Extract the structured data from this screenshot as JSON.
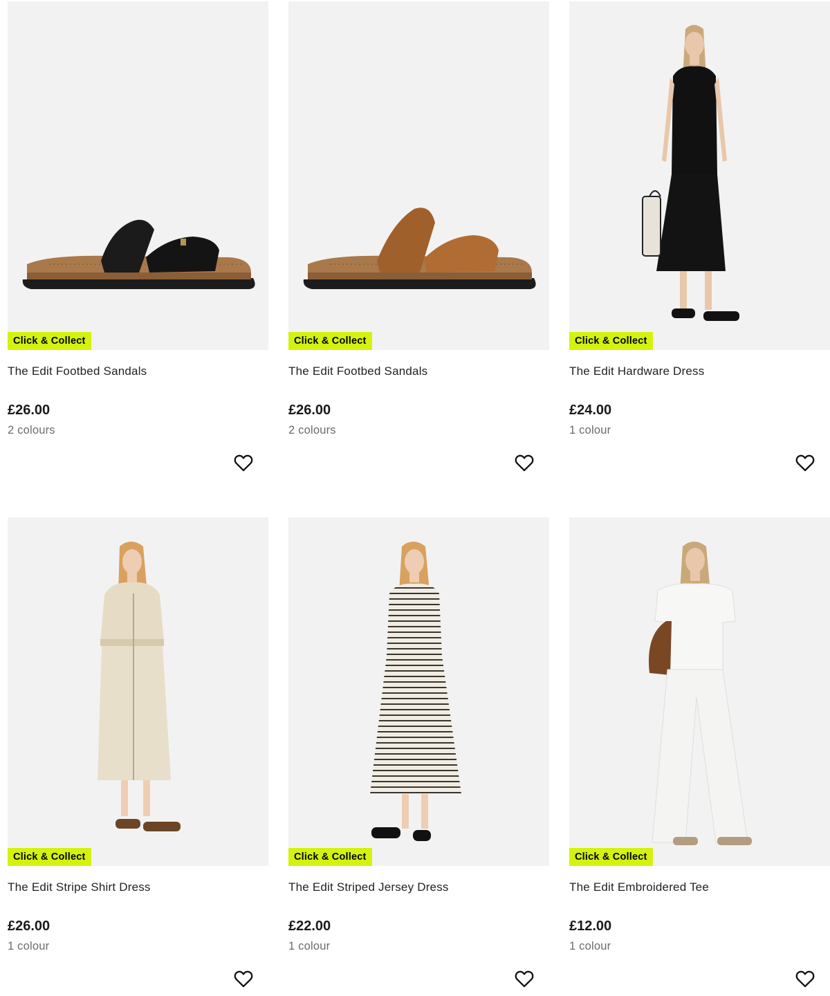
{
  "products": [
    {
      "badge": "Click & Collect",
      "name": "The Edit Footbed Sandals",
      "price": "£26.00",
      "colours": "2 colours",
      "image": "black-suede-footbed-sandal"
    },
    {
      "badge": "Click & Collect",
      "name": "The Edit Footbed Sandals",
      "price": "£26.00",
      "colours": "2 colours",
      "image": "tan-suede-footbed-sandal"
    },
    {
      "badge": "Click & Collect",
      "name": "The Edit Hardware Dress",
      "price": "£24.00",
      "colours": "1 colour",
      "image": "model-black-midi-dress"
    },
    {
      "badge": "Click & Collect",
      "name": "The Edit Stripe Shirt Dress",
      "price": "£26.00",
      "colours": "1 colour",
      "image": "model-beige-shirt-dress"
    },
    {
      "badge": "Click & Collect",
      "name": "The Edit Striped Jersey Dress",
      "price": "£22.00",
      "colours": "1 colour",
      "image": "model-striped-jersey-dress"
    },
    {
      "badge": "Click & Collect",
      "name": "The Edit Embroidered Tee",
      "price": "£12.00",
      "colours": "1 colour",
      "image": "model-white-tee-wide-trousers"
    }
  ],
  "colors": {
    "badge_bg": "#d4f20d",
    "image_bg": "#f2f2f2",
    "price_text": "#1a1a1a",
    "muted_text": "#6b6b6b"
  },
  "icons": {
    "wishlist": "heart-outline-icon"
  }
}
